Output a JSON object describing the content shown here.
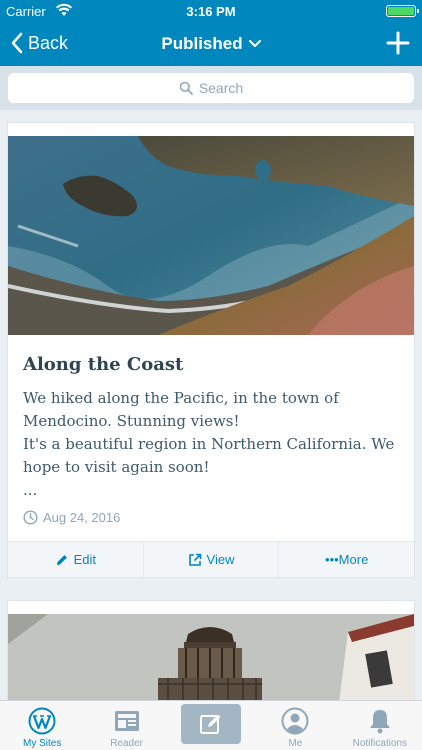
{
  "status_bar": {
    "carrier": "Carrier",
    "time": "3:16 PM"
  },
  "nav": {
    "back_label": "Back",
    "title": "Published"
  },
  "search": {
    "placeholder": "Search"
  },
  "posts": [
    {
      "title": "Along the Coast",
      "excerpt_lines": [
        "We hiked along the Pacific, in the town of",
        "Mendocino. Stunning views!",
        "It's a beautiful region in Northern California. We",
        "hope to visit again soon!",
        "..."
      ],
      "date": "Aug 24, 2016",
      "actions": {
        "edit": "Edit",
        "view": "View",
        "more": "•••More"
      }
    }
  ],
  "tabs": [
    {
      "label": "My Sites",
      "icon": "wordpress-icon",
      "active": true
    },
    {
      "label": "Reader",
      "icon": "reader-icon",
      "active": false
    },
    {
      "label": "",
      "icon": "new-post-icon",
      "active": false
    },
    {
      "label": "Me",
      "icon": "me-icon",
      "active": false
    },
    {
      "label": "Notifications",
      "icon": "bell-icon",
      "active": false
    }
  ],
  "colors": {
    "accent": "#0087be",
    "nav_bg": "#0087be",
    "page_bg": "#e9eff3",
    "title": "#2e4453",
    "muted": "#8fa7b8"
  }
}
